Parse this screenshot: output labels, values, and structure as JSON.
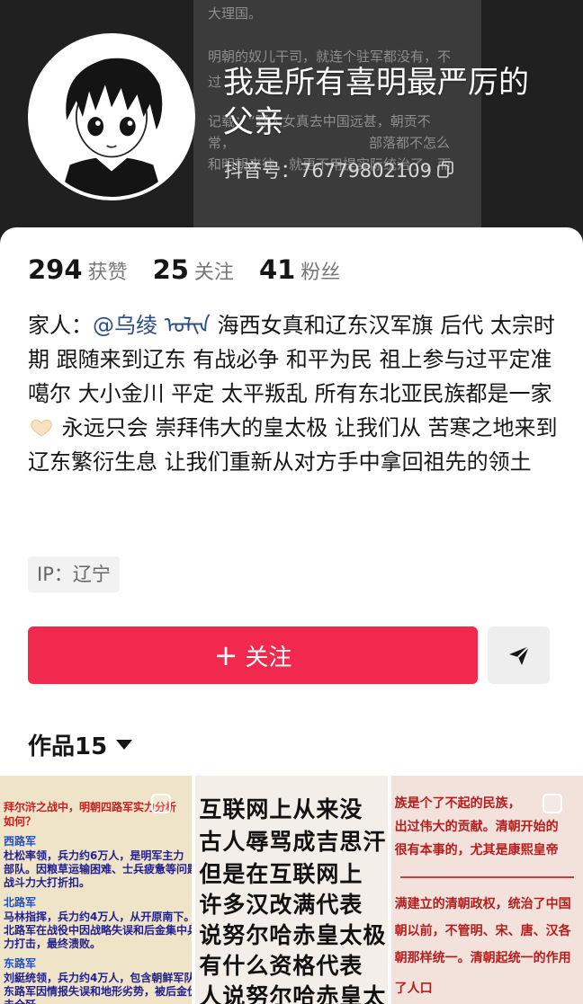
{
  "header": {
    "bg_lines": [
      "大理国。",
      "明朝的奴儿干司，就连个驻军都没有，不",
      "过",
      "记载：“野人女真去中国远甚，朝贡不",
      "常，",
      "部落都不怎么",
      "和明朝来往，就更不用提实际统治了。而"
    ],
    "username": "我是所有喜明最严厉的父亲",
    "douyin_id": "抖音号：76779802109"
  },
  "stats": [
    {
      "value": "294",
      "label": "获赞"
    },
    {
      "value": "25",
      "label": "关注"
    },
    {
      "value": "41",
      "label": "粉丝"
    }
  ],
  "bio": {
    "prefix": "家人：",
    "mention": "@乌绫 ",
    "script_text": "ᠤᠯᠢᠨ",
    "text1": " 海西女真和辽东汉军旗  后代 太宗时期 跟随来到辽东        有战必争 和平为民 祖上参与过平定准噶尔  大小金川 平定 太平叛乱    所有东北亚民族都是一家",
    "text2": "  永远只会 崇拜伟大的皇太极  让我们从 苦寒之地来到辽东繁衍生息    让我们重新从对方手中拿回祖先的领土"
  },
  "ip": "IP：辽宁",
  "follow_label": "关注",
  "works": {
    "label": "作品",
    "count": "15"
  },
  "thumbs": {
    "t1": [
      "拜尔浒之战中，明朝四路军实力分析",
      "如何？",
      "西路军",
      "杜松率领，兵力约6万人，是明军主力",
      "部队。因粮草运输困难、士兵疲惫等问题，",
      "战斗力大打折扣。",
      "北路军",
      "马林指挥，兵力约4万人，从开原南下。",
      "北路军在战役中因战略失误和后金集中兵",
      "力打击，最终溃败。",
      "东路军",
      "刘綎统领，兵力约4万人，包含朝鲜军队。",
      "东路军因情报失误和地形劣势，被后金伏",
      "击全歼。"
    ],
    "t2": [
      "互联网上从来没",
      "古人辱骂成吉思汗",
      "但是在互联网上",
      "许多汉改满代表",
      "说努尔哈赤皇太极",
      "有什么资格代表",
      "人说努尔哈赤皇太"
    ],
    "t3": [
      "族是个了不起的民族，",
      "出过伟大的贡献。清朝开始的",
      "很有本事的，尤其是康熙皇帝",
      "满建立的清朝政权，统治了中国",
      "朝以前，不管明、宋、唐、汉各",
      "朝那样统一。清朝起统一的作用",
      "了人口"
    ]
  },
  "colors": {
    "accent": "#f1294e",
    "mention": "#2b4c8c"
  }
}
